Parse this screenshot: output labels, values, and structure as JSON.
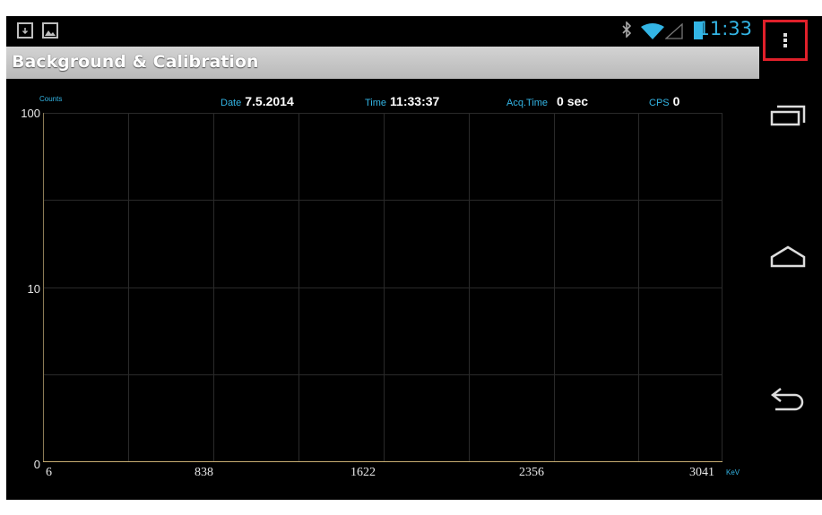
{
  "status_bar": {
    "time": "11:33",
    "icons": [
      "download-icon",
      "image-icon",
      "bluetooth-icon",
      "wifi-icon",
      "signal-icon",
      "battery-icon"
    ]
  },
  "action_bar": {
    "title": "Background & Calibration"
  },
  "info": {
    "date_label": "Date",
    "date_value": "7.5.2014",
    "time_label": "Time",
    "time_value": "11:33:37",
    "acq_label": "Acq.Time",
    "acq_value": "0 sec",
    "cps_label": "CPS",
    "cps_value": "0"
  },
  "chart_data": {
    "type": "line",
    "ylabel": "Counts",
    "xlabel": "KeV",
    "y_scale": "log",
    "y_ticks": [
      "100",
      "10",
      "0"
    ],
    "x_ticks": [
      "6",
      "838",
      "1622",
      "2356",
      "3041"
    ],
    "series": []
  },
  "nav_bar": {
    "icons": [
      "overflow-menu-icon",
      "recent-apps-icon",
      "home-icon",
      "back-icon"
    ]
  },
  "colors": {
    "accent": "#33b5e5",
    "highlight_box": "#e0202a",
    "axis": "#c7ad72"
  }
}
